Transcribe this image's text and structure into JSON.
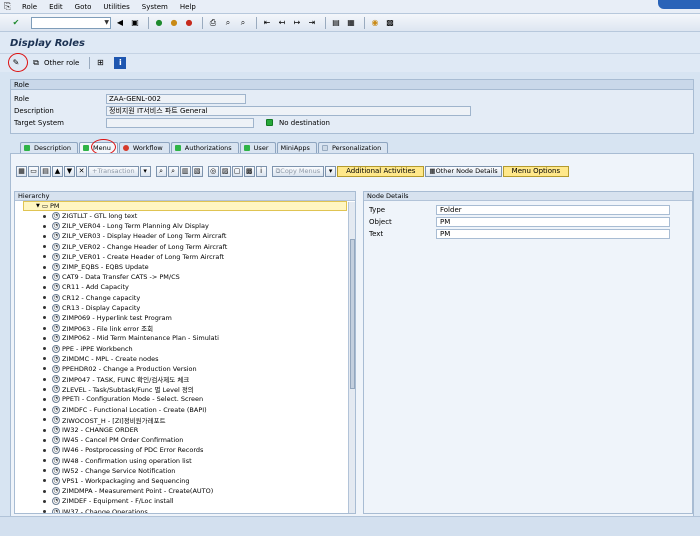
{
  "menubar": {
    "items": [
      "Role",
      "Edit",
      "Goto",
      "Utilities",
      "System",
      "Help"
    ]
  },
  "toolbar": {
    "icons": [
      "check-icon",
      "save-icon",
      "back-icon",
      "exit-icon",
      "cancel-icon",
      "print-icon",
      "find-icon",
      "find-next-icon",
      "first-page-icon",
      "prev-page-icon",
      "next-page-icon",
      "last-page-icon",
      "new-session-icon",
      "shortcut-icon",
      "help-icon",
      "layout-icon"
    ]
  },
  "page": {
    "title": "Display Roles"
  },
  "apptoolbar": {
    "other_role": "Other role"
  },
  "role": {
    "group_title": "Role",
    "role_label": "Role",
    "role_value": "ZAA-GENL-002",
    "description_label": "Description",
    "description_value": "정비지원 IT서비스 파트 General",
    "target_label": "Target System",
    "target_value": "",
    "target_status": "No destination"
  },
  "tabs": [
    {
      "label": "Description",
      "status": "green"
    },
    {
      "label": "Menu",
      "status": "green"
    },
    {
      "label": "Workflow",
      "status": "red"
    },
    {
      "label": "Authorizations",
      "status": "green"
    },
    {
      "label": "User",
      "status": "green"
    },
    {
      "label": "MiniApps",
      "status": "none"
    },
    {
      "label": "Personalization",
      "status": "none"
    }
  ],
  "menu_toolbar": {
    "transaction": "Transaction",
    "copy_menus": "Copy Menus",
    "additional_activities": "Additional Activities",
    "other_node_details": "Other Node Details",
    "menu_options": "Menu Options"
  },
  "hierarchy": {
    "header": "Hierarchy",
    "root": "PM",
    "nodes": [
      "ZIGTLLT - GTL long text",
      "ZILP_VER04 - Long Term Planning Alv Display",
      "ZILP_VER03 - Display Header of Long Term Aircraft",
      "ZILP_VER02 - Change Header of Long Term Aircraft",
      "ZILP_VER01 - Create Header of Long Term Aircraft",
      "ZIMP_EQBS - EQBS Update",
      "CAT9 - Data Transfer CATS -> PM/CS",
      "CR11 - Add Capacity",
      "CR12 - Change capacity",
      "CR13 - Display Capacity",
      "ZIMP069 - Hyperlink test Program",
      "ZIMP063 - File link error 조회",
      "ZIMP062 - Mid Term Maintenance Plan - Simulati",
      "PPE - iPPE Workbench",
      "ZIMDMC - MPL - Create nodes",
      "PPEHDR02 - Change a Production Version",
      "ZIMP047 - TASK, FUNC 확인/검사제도 체크",
      "ZLEVEL - Task/Subtask/Func 별 Level 정의",
      "PPETI - Configuration Mode - Select. Screen",
      "ZIMDFC - Functional Location - Create (BAPI)",
      "ZIWOCOST_H - [ZI]정비원가레포트",
      "IW32 - CHANGE ORDER",
      "IW45 - Cancel PM Order Confirmation",
      "IW46 - Postprocessing of PDC Error Records",
      "IW48 - Confirmation using operation list",
      "IW52 - Change Service Notification",
      "VPS1 - Workpackaging and Sequencing",
      "ZIMDMPA - Measurement Point - Create(AUTO)",
      "ZIMDEF - Equipment - F/Loc install",
      "IW37 - Change Operations"
    ]
  },
  "node_details": {
    "header": "Node Details",
    "rows": [
      {
        "label": "Type",
        "value": "Folder"
      },
      {
        "label": "Object",
        "value": "PM"
      },
      {
        "label": "Text",
        "value": "PM"
      }
    ]
  }
}
